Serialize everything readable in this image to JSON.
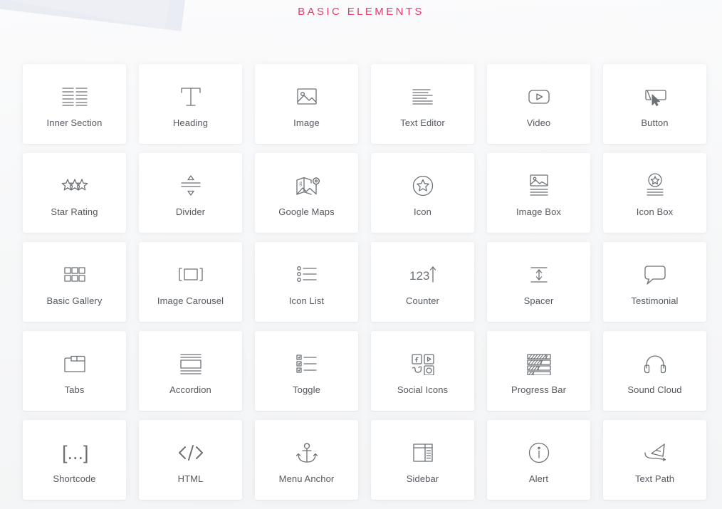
{
  "page": {
    "title": "BASIC ELEMENTS",
    "title_color": "#e8386a",
    "background_color": "#f5f6f7",
    "card_color": "#ffffff",
    "label_color": "#54595f",
    "icon_color": "#6d7276"
  },
  "grid": {
    "columns": 6,
    "rows": 5,
    "items": [
      {
        "label": "Inner Section",
        "icon": "inner-section-icon"
      },
      {
        "label": "Heading",
        "icon": "heading-t-icon"
      },
      {
        "label": "Image",
        "icon": "image-picture-icon"
      },
      {
        "label": "Text Editor",
        "icon": "text-lines-icon"
      },
      {
        "label": "Video",
        "icon": "video-play-icon"
      },
      {
        "label": "Button",
        "icon": "button-cursor-icon"
      },
      {
        "label": "Star Rating",
        "icon": "three-stars-icon"
      },
      {
        "label": "Divider",
        "icon": "divider-arrows-icon"
      },
      {
        "label": "Google Maps",
        "icon": "map-pin-icon"
      },
      {
        "label": "Icon",
        "icon": "star-circle-icon"
      },
      {
        "label": "Image Box",
        "icon": "image-box-icon"
      },
      {
        "label": "Icon Box",
        "icon": "icon-box-icon"
      },
      {
        "label": "Basic Gallery",
        "icon": "gallery-grid-icon"
      },
      {
        "label": "Image Carousel",
        "icon": "carousel-icon"
      },
      {
        "label": "Icon List",
        "icon": "icon-list-icon"
      },
      {
        "label": "Counter",
        "icon": "counter-123-arrow-icon",
        "icon_text": "123"
      },
      {
        "label": "Spacer",
        "icon": "spacer-arrows-icon"
      },
      {
        "label": "Testimonial",
        "icon": "speech-bubble-icon"
      },
      {
        "label": "Tabs",
        "icon": "tabs-folder-icon"
      },
      {
        "label": "Accordion",
        "icon": "accordion-icon"
      },
      {
        "label": "Toggle",
        "icon": "toggle-list-icon"
      },
      {
        "label": "Social Icons",
        "icon": "social-icons-icon"
      },
      {
        "label": "Progress Bar",
        "icon": "progress-bars-icon"
      },
      {
        "label": "Sound Cloud",
        "icon": "headphones-icon"
      },
      {
        "label": "Shortcode",
        "icon": "shortcode-brackets-icon",
        "icon_text": "[...]"
      },
      {
        "label": "HTML",
        "icon": "code-tags-icon",
        "icon_text": "</>"
      },
      {
        "label": "Menu Anchor",
        "icon": "anchor-icon"
      },
      {
        "label": "Sidebar",
        "icon": "sidebar-layout-icon"
      },
      {
        "label": "Alert",
        "icon": "info-circle-icon"
      },
      {
        "label": "Text Path",
        "icon": "text-path-icon"
      }
    ]
  }
}
